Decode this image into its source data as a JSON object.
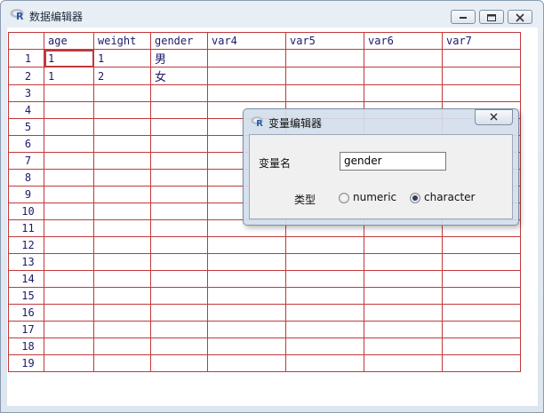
{
  "window": {
    "title": "数据编辑器",
    "logo_letter": "R",
    "accent_color": "#c0393b"
  },
  "grid": {
    "columns": [
      "age",
      "weight",
      "gender",
      "var4",
      "var5",
      "var6",
      "var7"
    ],
    "rows": [
      {
        "num": "1",
        "cells": [
          "1",
          "1",
          "男",
          "",
          "",
          "",
          ""
        ]
      },
      {
        "num": "2",
        "cells": [
          "1",
          "2",
          "女",
          "",
          "",
          "",
          ""
        ]
      },
      {
        "num": "3",
        "cells": [
          "",
          "",
          "",
          "",
          "",
          "",
          ""
        ]
      },
      {
        "num": "4",
        "cells": [
          "",
          "",
          "",
          "",
          "",
          "",
          ""
        ]
      },
      {
        "num": "5",
        "cells": [
          "",
          "",
          "",
          "",
          "",
          "",
          ""
        ]
      },
      {
        "num": "6",
        "cells": [
          "",
          "",
          "",
          "",
          "",
          "",
          ""
        ]
      },
      {
        "num": "7",
        "cells": [
          "",
          "",
          "",
          "",
          "",
          "",
          ""
        ]
      },
      {
        "num": "8",
        "cells": [
          "",
          "",
          "",
          "",
          "",
          "",
          ""
        ]
      },
      {
        "num": "9",
        "cells": [
          "",
          "",
          "",
          "",
          "",
          "",
          ""
        ]
      },
      {
        "num": "10",
        "cells": [
          "",
          "",
          "",
          "",
          "",
          "",
          ""
        ]
      },
      {
        "num": "11",
        "cells": [
          "",
          "",
          "",
          "",
          "",
          "",
          ""
        ]
      },
      {
        "num": "12",
        "cells": [
          "",
          "",
          "",
          "",
          "",
          "",
          ""
        ]
      },
      {
        "num": "13",
        "cells": [
          "",
          "",
          "",
          "",
          "",
          "",
          ""
        ]
      },
      {
        "num": "14",
        "cells": [
          "",
          "",
          "",
          "",
          "",
          "",
          ""
        ]
      },
      {
        "num": "15",
        "cells": [
          "",
          "",
          "",
          "",
          "",
          "",
          ""
        ]
      },
      {
        "num": "16",
        "cells": [
          "",
          "",
          "",
          "",
          "",
          "",
          ""
        ]
      },
      {
        "num": "17",
        "cells": [
          "",
          "",
          "",
          "",
          "",
          "",
          ""
        ]
      },
      {
        "num": "18",
        "cells": [
          "",
          "",
          "",
          "",
          "",
          "",
          ""
        ]
      },
      {
        "num": "19",
        "cells": [
          "",
          "",
          "",
          "",
          "",
          "",
          ""
        ]
      }
    ]
  },
  "dialog": {
    "title": "变量编辑器",
    "name_label": "变量名",
    "name_value": "gender",
    "type_label": "类型",
    "options": [
      {
        "label": "numeric",
        "selected": false
      },
      {
        "label": "character",
        "selected": true
      }
    ]
  }
}
